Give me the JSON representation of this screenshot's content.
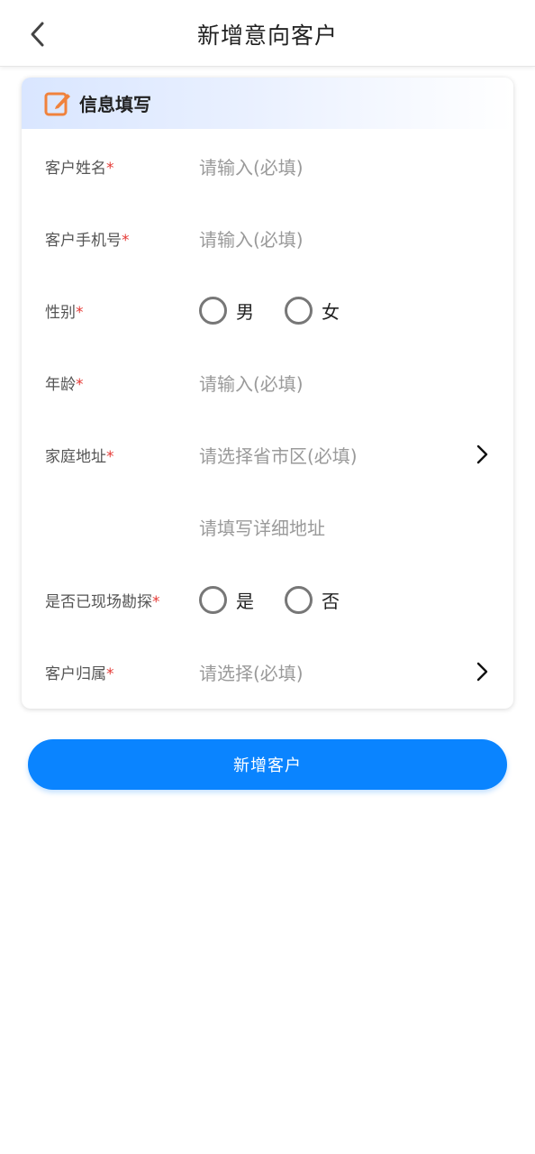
{
  "header": {
    "title": "新增意向客户",
    "back_icon": "chevron-left-icon"
  },
  "card": {
    "title": "信息填写",
    "title_icon": "edit-icon",
    "accent_color": "#f0823c"
  },
  "form": {
    "required_mark": "*",
    "name": {
      "label": "客户姓名",
      "placeholder": "请输入(必填)"
    },
    "phone": {
      "label": "客户手机号",
      "placeholder": "请输入(必填)"
    },
    "gender": {
      "label": "性别",
      "options": [
        "男",
        "女"
      ]
    },
    "age": {
      "label": "年龄",
      "placeholder": "请输入(必填)"
    },
    "address": {
      "label": "家庭地址",
      "placeholder": "请选择省市区(必填)",
      "detail_placeholder": "请填写详细地址"
    },
    "surveyed": {
      "label": "是否已现场勘探",
      "options": [
        "是",
        "否"
      ]
    },
    "owner": {
      "label": "客户归属",
      "placeholder": "请选择(必填)"
    }
  },
  "submit": {
    "label": "新增客户",
    "color": "#0a84ff"
  }
}
